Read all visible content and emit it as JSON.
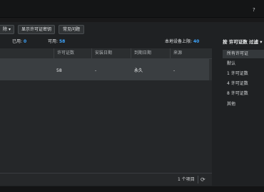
{
  "window": {
    "help_icon": "?"
  },
  "toolbar": {
    "left_button_fragment": "除 ▾",
    "show_key_button": "显示许可证密钥",
    "faq_button": "常见问题"
  },
  "stats": {
    "used_label": "已用:",
    "used_value": "0",
    "available_label": "可用:",
    "available_value": "58",
    "local_limit_label": "本地设备上限:",
    "local_limit_value": "40"
  },
  "table": {
    "columns": [
      "许可证数",
      "安装日期",
      "到期日期",
      "来源"
    ],
    "rows": [
      {
        "license_count": "58",
        "install_date": "-",
        "expiry_date": "永久",
        "source": "-"
      }
    ]
  },
  "footer": {
    "item_count": "1 个项目",
    "refresh_icon": "refresh-icon"
  },
  "filter": {
    "title": "按 许可证数 过滤 ▾",
    "items": [
      {
        "label": "所有许可证",
        "selected": true
      },
      {
        "label": "默认",
        "selected": false
      },
      {
        "label": "1 许可证数",
        "selected": false
      },
      {
        "label": "4 许可证数",
        "selected": false
      },
      {
        "label": "8 许可证数",
        "selected": false
      },
      {
        "label": "其他",
        "selected": false
      }
    ]
  }
}
